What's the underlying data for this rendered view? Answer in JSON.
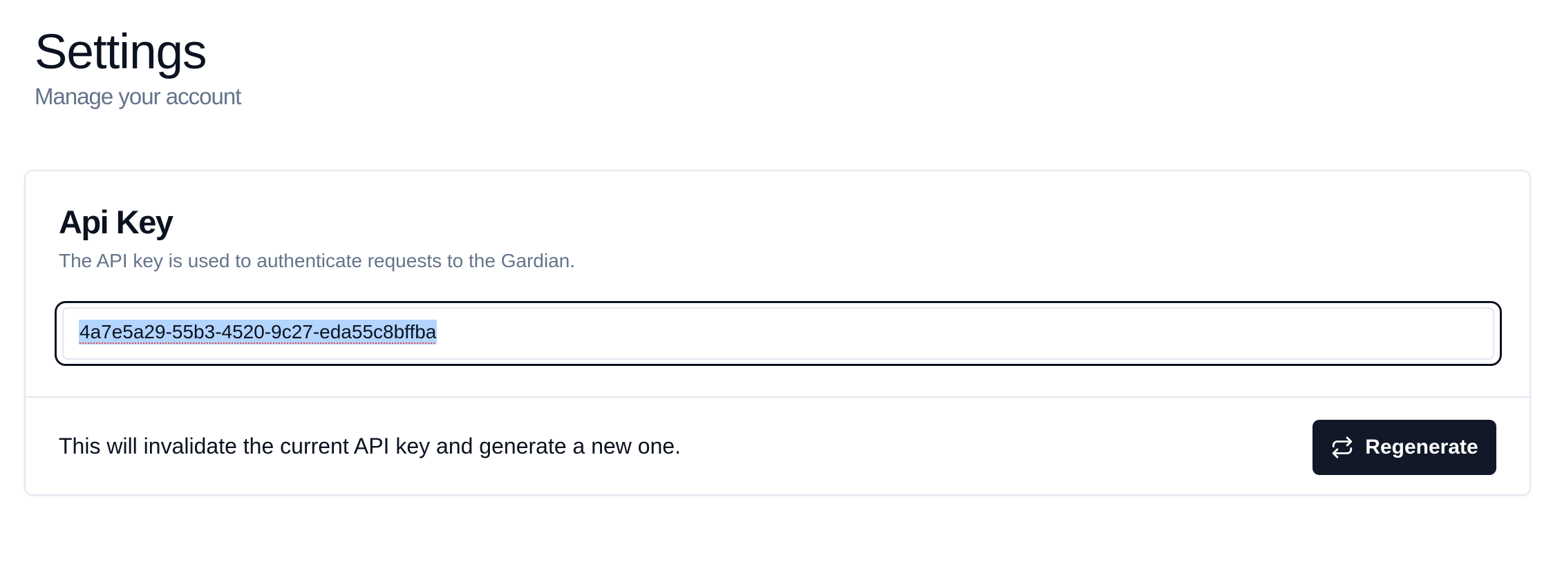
{
  "header": {
    "title": "Settings",
    "subtitle": "Manage your account"
  },
  "api_key_card": {
    "title": "Api Key",
    "description": "The API key is used to authenticate requests to the Gardian.",
    "key_value": "4a7e5a29-55b3-4520-9c27-eda55c8bffba",
    "footer_text": "This will invalidate the current API key and generate a new one.",
    "regenerate_label": "Regenerate",
    "regenerate_icon": "repeat-icon"
  },
  "colors": {
    "accent": "#111827",
    "muted_text": "#64748b",
    "border": "#e2e8f0",
    "selection": "#b4d5fe"
  }
}
